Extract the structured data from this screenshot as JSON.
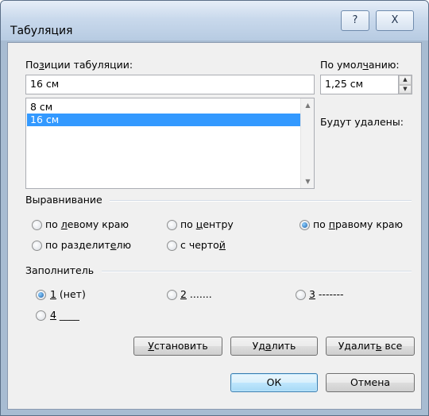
{
  "window": {
    "title": "Табуляция",
    "help_glyph": "?",
    "close_glyph": "X"
  },
  "tab_positions": {
    "label_pre": "По",
    "label_u": "з",
    "label_post": "иции табуляции:",
    "value": "16 см",
    "items": [
      "8 см",
      "16 см"
    ],
    "selected_index": 1
  },
  "default_stops": {
    "label_pre": "По умол",
    "label_u": "ч",
    "label_post": "анию:",
    "value": "1,25 см"
  },
  "to_be_cleared": {
    "label": "Будут удалены:"
  },
  "alignment": {
    "label": "Выравнивание",
    "options": [
      {
        "pre": "по ",
        "u": "л",
        "post": "евому краю",
        "selected": false
      },
      {
        "pre": "по ",
        "u": "ц",
        "post": "ентру",
        "selected": false
      },
      {
        "pre": "по ",
        "u": "п",
        "post": "равому краю",
        "selected": true
      },
      {
        "pre": "по разделит",
        "u": "е",
        "post": "лю",
        "selected": false
      },
      {
        "pre": "с черто",
        "u": "й",
        "post": "",
        "selected": false
      }
    ]
  },
  "leader": {
    "label": "Заполнитель",
    "options": [
      {
        "u": "1",
        "post": " (нет)",
        "selected": true
      },
      {
        "u": "2",
        "post": " .......",
        "selected": false
      },
      {
        "u": "3",
        "post": " -------",
        "selected": false
      },
      {
        "u": "4",
        "post": " ____",
        "selected": false
      }
    ]
  },
  "buttons": {
    "set_u": "У",
    "set_post": "становить",
    "clear_pre": "Уд",
    "clear_u": "а",
    "clear_post": "лить",
    "clear_all_pre": "Удалит",
    "clear_all_u": "ь",
    "clear_all_post": " все",
    "ok": "ОК",
    "cancel": "Отмена"
  }
}
